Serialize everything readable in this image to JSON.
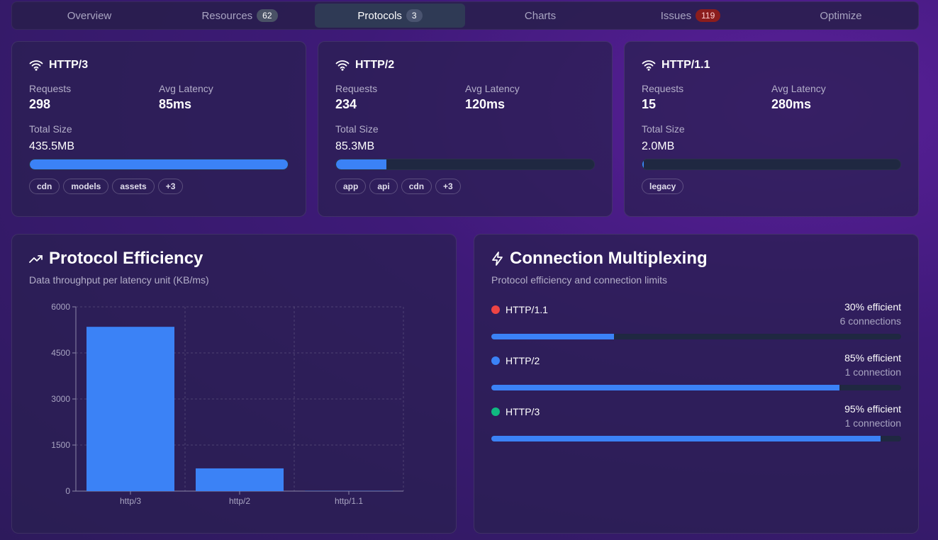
{
  "tabs": [
    {
      "label": "Overview",
      "badge": null,
      "active": false
    },
    {
      "label": "Resources",
      "badge": "62",
      "active": false
    },
    {
      "label": "Protocols",
      "badge": "3",
      "active": true
    },
    {
      "label": "Charts",
      "badge": null,
      "active": false
    },
    {
      "label": "Issues",
      "badge": "119",
      "active": false
    },
    {
      "label": "Optimize",
      "badge": null,
      "active": false
    }
  ],
  "cards": [
    {
      "title": "HTTP/3",
      "requests_label": "Requests",
      "requests": "298",
      "latency_label": "Avg Latency",
      "latency": "85ms",
      "size_label": "Total Size",
      "size": "435.5MB",
      "fill_percent": 100,
      "tags": [
        "cdn",
        "models",
        "assets",
        "+3"
      ]
    },
    {
      "title": "HTTP/2",
      "requests_label": "Requests",
      "requests": "234",
      "latency_label": "Avg Latency",
      "latency": "120ms",
      "size_label": "Total Size",
      "size": "85.3MB",
      "fill_percent": 19.6,
      "tags": [
        "app",
        "api",
        "cdn",
        "+3"
      ]
    },
    {
      "title": "HTTP/1.1",
      "requests_label": "Requests",
      "requests": "15",
      "latency_label": "Avg Latency",
      "latency": "280ms",
      "size_label": "Total Size",
      "size": "2.0MB",
      "fill_percent": 0.5,
      "tags": [
        "legacy"
      ]
    }
  ],
  "efficiency": {
    "title": "Protocol Efficiency",
    "subtitle": "Data throughput per latency unit (KB/ms)"
  },
  "chart_data": {
    "type": "bar",
    "categories": [
      "http/3",
      "http/2",
      "http/1.1"
    ],
    "values": [
      5350,
      740,
      7
    ],
    "title": "Protocol Efficiency",
    "xlabel": "",
    "ylabel": "",
    "ylim": [
      0,
      6000
    ],
    "yticks": [
      0,
      1500,
      3000,
      4500,
      6000
    ],
    "grid": true,
    "color": "#3b82f6"
  },
  "multiplexing": {
    "title": "Connection Multiplexing",
    "subtitle": "Protocol efficiency and connection limits",
    "rows": [
      {
        "name": "HTTP/1.1",
        "color": "#ef4444",
        "efficiency": "30% efficient",
        "connections": "6 connections",
        "percent": 30
      },
      {
        "name": "HTTP/2",
        "color": "#3b82f6",
        "efficiency": "85% efficient",
        "connections": "1 connection",
        "percent": 85
      },
      {
        "name": "HTTP/3",
        "color": "#10b981",
        "efficiency": "95% efficient",
        "connections": "1 connection",
        "percent": 95
      }
    ]
  },
  "colors": {
    "accent": "#3b82f6",
    "track": "#1f2841"
  }
}
